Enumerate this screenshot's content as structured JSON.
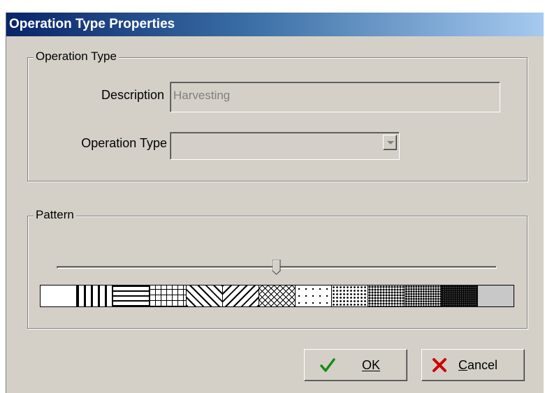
{
  "window": {
    "title": "Operation Type Properties"
  },
  "operation_group": {
    "legend": "Operation Type",
    "description_label": "Description",
    "description_value": "Harvesting",
    "type_label": "Operation Type",
    "type_value": ""
  },
  "pattern_group": {
    "legend": "Pattern",
    "slider_fraction": 0.5,
    "swatches": [
      "solid",
      "vertical",
      "horizontal",
      "cross",
      "diagonal-fwd",
      "diagonal-back",
      "diagonal-cross",
      "dots-sparse",
      "dots-medium",
      "dots-dense",
      "dots-denser",
      "dots-heavy",
      "dots-heaviest"
    ]
  },
  "buttons": {
    "ok_label": "OK",
    "cancel_label": "Cancel"
  },
  "icons": {
    "ok": "checkmark-icon",
    "cancel": "x-icon"
  },
  "colors": {
    "face": "#d4d0c8",
    "title_start": "#0a246a",
    "title_end": "#a6caf0",
    "ok_check": "#1a8a1a",
    "cancel_x": "#cc0000"
  }
}
